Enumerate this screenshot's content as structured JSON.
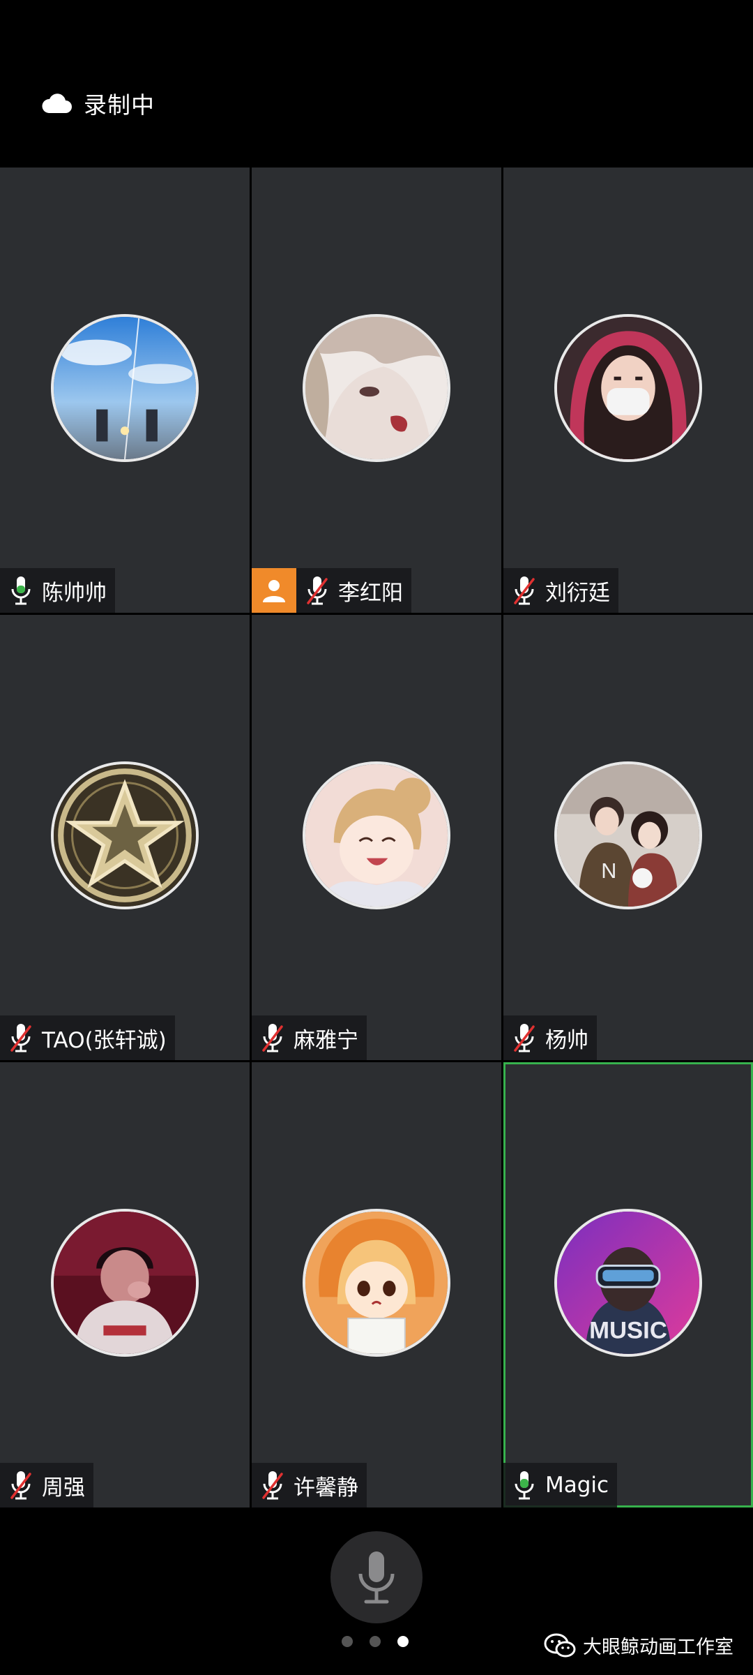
{
  "status": {
    "recording_label": "录制中"
  },
  "participants": [
    {
      "name": "陈帅帅",
      "mic": "on",
      "avatar": "anime-sky-scene",
      "host": false
    },
    {
      "name": "李红阳",
      "mic": "muted",
      "avatar": "anime-girl-closeup",
      "host": true
    },
    {
      "name": "刘衍廷",
      "mic": "muted",
      "avatar": "masked-girl-photo",
      "host": false
    },
    {
      "name": "TAO(张轩诚)",
      "mic": "muted",
      "avatar": "gold-star-emblem",
      "host": false
    },
    {
      "name": "麻雅宁",
      "mic": "muted",
      "avatar": "anime-smiling-girl",
      "host": false
    },
    {
      "name": "杨帅",
      "mic": "muted",
      "avatar": "couple-photo",
      "host": false
    },
    {
      "name": "周强",
      "mic": "muted",
      "avatar": "red-tint-portrait",
      "host": false
    },
    {
      "name": "许馨静",
      "mic": "muted",
      "avatar": "anime-umaru",
      "host": false
    },
    {
      "name": "Magic",
      "mic": "on",
      "avatar": "music-vr-character",
      "host": false,
      "active_speaker": true
    }
  ],
  "pager": {
    "pages": 3,
    "current": 3
  },
  "watermark": {
    "text": "大眼鲸动画工作室",
    "icon": "wechat-icon"
  },
  "colors": {
    "tile_bg": "#2c2e31",
    "mic_on": "#3cb44a",
    "mic_muted": "#e03131",
    "host_badge": "#f08a2a",
    "active_border": "#37b24d"
  }
}
